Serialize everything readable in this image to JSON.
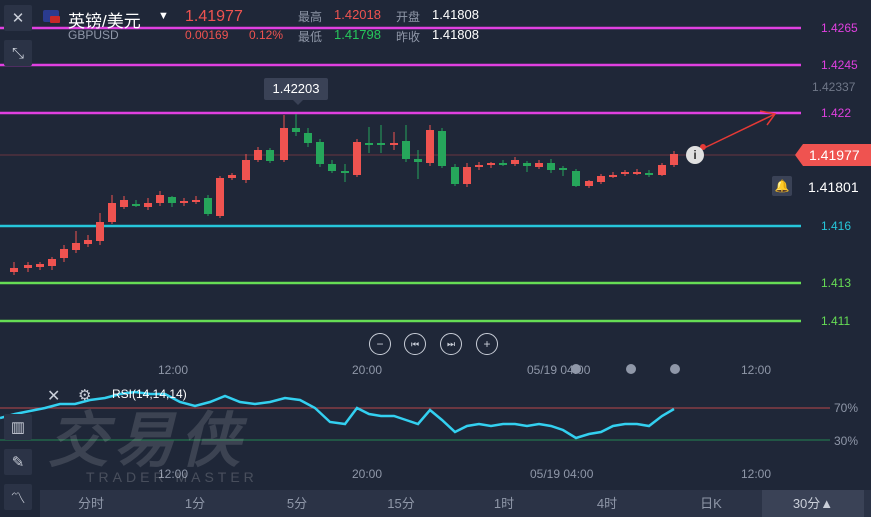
{
  "header": {
    "pair_name": "英镑/美元",
    "symbol": "GBPUSD",
    "last_price": "1.41977",
    "change": "0.00169",
    "change_pct": "0.12%",
    "high_label": "最高",
    "high_value": "1.42018",
    "open_label": "开盘",
    "open_value": "1.41808",
    "low_label": "最低",
    "low_value": "1.41798",
    "prev_close_label": "昨收",
    "prev_close_value": "1.41808"
  },
  "price_axis": {
    "levels": [
      {
        "value": "1.4265",
        "color": "#e040e0"
      },
      {
        "value": "1.4245",
        "color": "#e040e0"
      },
      {
        "value": "1.422",
        "color": "#e040e0"
      },
      {
        "value": "1.416",
        "color": "#26c6da"
      },
      {
        "value": "1.413",
        "color": "#66dd55"
      },
      {
        "value": "1.411",
        "color": "#66dd55"
      }
    ],
    "axis_label": "1.42337",
    "current_price_tag": "1.41977",
    "alert_price": "1.41801",
    "high_callout": "1.42203"
  },
  "time_axis": {
    "ticks": [
      "12:00",
      "20:00",
      "05/19 04:00",
      "12:00"
    ]
  },
  "rsi": {
    "label": "RSI(14,14,14)",
    "upper_label": "70%",
    "lower_label": "30%"
  },
  "watermark": {
    "text": "交易侠",
    "sub": "TRADER MASTER"
  },
  "period_tabs": [
    {
      "label": "分时"
    },
    {
      "label": "1分"
    },
    {
      "label": "5分"
    },
    {
      "label": "15分"
    },
    {
      "label": "1时"
    },
    {
      "label": "4时"
    },
    {
      "label": "日K"
    },
    {
      "label": "30分▲"
    }
  ],
  "colors": {
    "up": "#ef5350",
    "down": "#26a65b",
    "rsi_line": "#33d0f0",
    "background": "#1f2738"
  },
  "chart_data": {
    "type": "candlestick",
    "approx_start_price": 1.4145,
    "approx_end_price": 1.41977
  }
}
